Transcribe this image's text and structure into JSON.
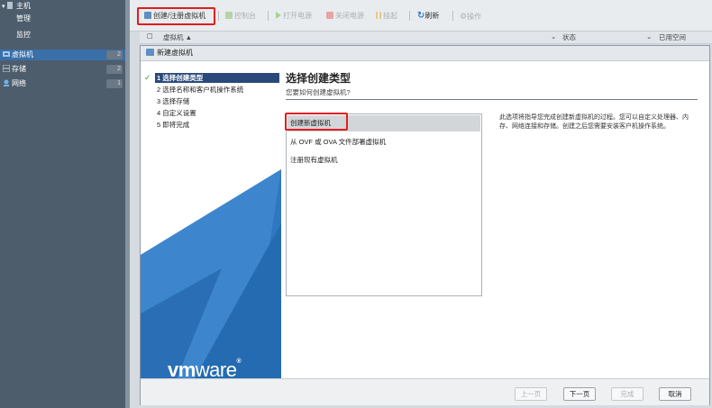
{
  "nav": {
    "host": "主机",
    "manage": "管理",
    "monitor": "监控",
    "items": [
      {
        "label": "虚拟机",
        "count": "2",
        "icon": "vm-icon"
      },
      {
        "label": "存储",
        "count": "2",
        "icon": "storage-icon"
      },
      {
        "label": "网络",
        "count": "1",
        "icon": "network-icon"
      }
    ]
  },
  "toolbar": {
    "create": "创建/注册虚拟机",
    "console": "控制台",
    "power_on": "打开电源",
    "power_off": "关闭电源",
    "suspend": "挂起",
    "refresh": "刷新",
    "actions": "操作"
  },
  "grid": {
    "col_vm": "虚拟机 ▲",
    "col_status": "状态",
    "col_used": "已用空间"
  },
  "dialog": {
    "title": "新建虚拟机",
    "steps": [
      "1 选择创建类型",
      "2 选择名称和客户机操作系统",
      "3 选择存储",
      "4 自定义设置",
      "5 即将完成"
    ],
    "logo_vm": "vm",
    "logo_ware": "ware",
    "content_title": "选择创建类型",
    "content_subtitle": "您要如何创建虚拟机?",
    "options": [
      "创建新虚拟机",
      "从 OVF 或 OVA 文件部署虚拟机",
      "注册现有虚拟机"
    ],
    "description": "此选项将指导您完成创建新虚拟机的过程。您可以自定义处理器、内存、网络连接和存储。创建之后您需要安装客户机操作系统。",
    "buttons": {
      "back": "上一页",
      "next": "下一页",
      "finish": "完成",
      "cancel": "取消"
    }
  },
  "colors": {
    "nav_bg": "#4d5d6c",
    "step_active": "#29497a",
    "highlight": "#e21d1d",
    "graphic_blue": "#2f78c1"
  }
}
